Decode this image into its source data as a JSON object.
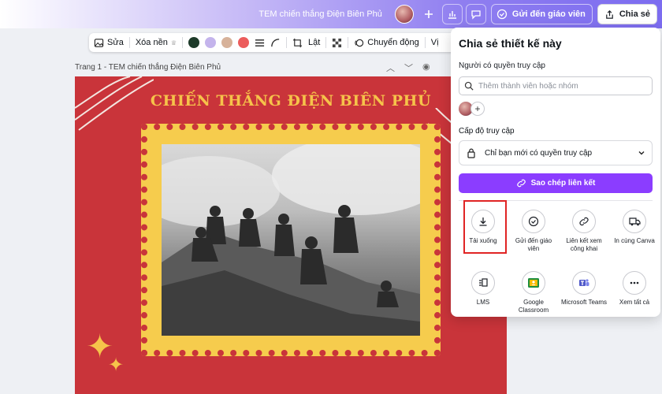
{
  "topbar": {
    "doc_title": "TEM chiến thắng Điện Biên Phủ",
    "send_label": "Gửi đến giáo viên",
    "share_label": "Chia sẻ"
  },
  "toolbar": {
    "edit_label": "Sửa",
    "bg_remove_label": "Xóa nền",
    "crop_label": "Lật",
    "animate_label": "Chuyển động",
    "more_label": "Vị",
    "swatches": [
      "#1e3b2a",
      "#c4b4ec",
      "#d7b29a",
      "#ec5c5c"
    ]
  },
  "page": {
    "label": "Trang 1 - TEM chiến thắng Điện Biên Phủ",
    "heading": "CHIẾN THẮNG ĐIỆN BIÊN PHỦ"
  },
  "share_panel": {
    "title": "Chia sẻ thiết kế này",
    "people_label": "Người có quyền truy cập",
    "search_placeholder": "Thêm thành viên hoặc nhóm",
    "access_label": "Cấp độ truy cập",
    "access_value": "Chỉ bạn mới có quyền truy cập",
    "copy_link_label": "Sao chép liên kết",
    "options": [
      {
        "label": "Tải xuống",
        "icon": "download-icon"
      },
      {
        "label": "Gửi đến giáo viên",
        "icon": "check-circle-icon"
      },
      {
        "label": "Liên kết xem công khai",
        "icon": "link-icon"
      },
      {
        "label": "In cùng Canva",
        "icon": "truck-icon"
      },
      {
        "label": "LMS",
        "icon": "lms-icon"
      },
      {
        "label": "Google Classroom",
        "icon": "google-classroom-icon"
      },
      {
        "label": "Microsoft Teams",
        "icon": "teams-icon"
      },
      {
        "label": "Xem tất cả",
        "icon": "more-icon"
      }
    ]
  },
  "colors": {
    "accent": "#8b3dff",
    "canvas_bg": "#c9343a",
    "stamp_gold": "#f6cc4d",
    "highlight": "#e02424"
  }
}
